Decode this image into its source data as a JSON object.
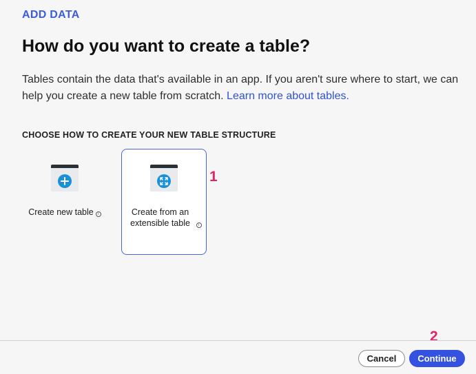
{
  "header": {
    "eyebrow": "ADD DATA",
    "title": "How do you want to create a table?",
    "description": "Tables contain the data that's available in an app. If you aren't sure where to start, we can help you create a new table from scratch.",
    "learn_more_link": "Learn more about tables."
  },
  "section": {
    "label": "CHOOSE HOW TO CREATE YOUR NEW TABLE STRUCTURE"
  },
  "options": [
    {
      "label": "Create new table",
      "icon": "plus-icon",
      "info_icon": "info-icon",
      "selected": false
    },
    {
      "label": "Create from an extensible table",
      "icon": "expand-arrows-icon",
      "info_icon": "info-icon",
      "selected": true
    }
  ],
  "annotations": {
    "step1": "1",
    "step2": "2"
  },
  "footer": {
    "cancel_label": "Cancel",
    "continue_label": "Continue"
  },
  "colors": {
    "accent": "#3451e0",
    "marker": "#e0246b",
    "icon_blue": "#1a90d6"
  }
}
